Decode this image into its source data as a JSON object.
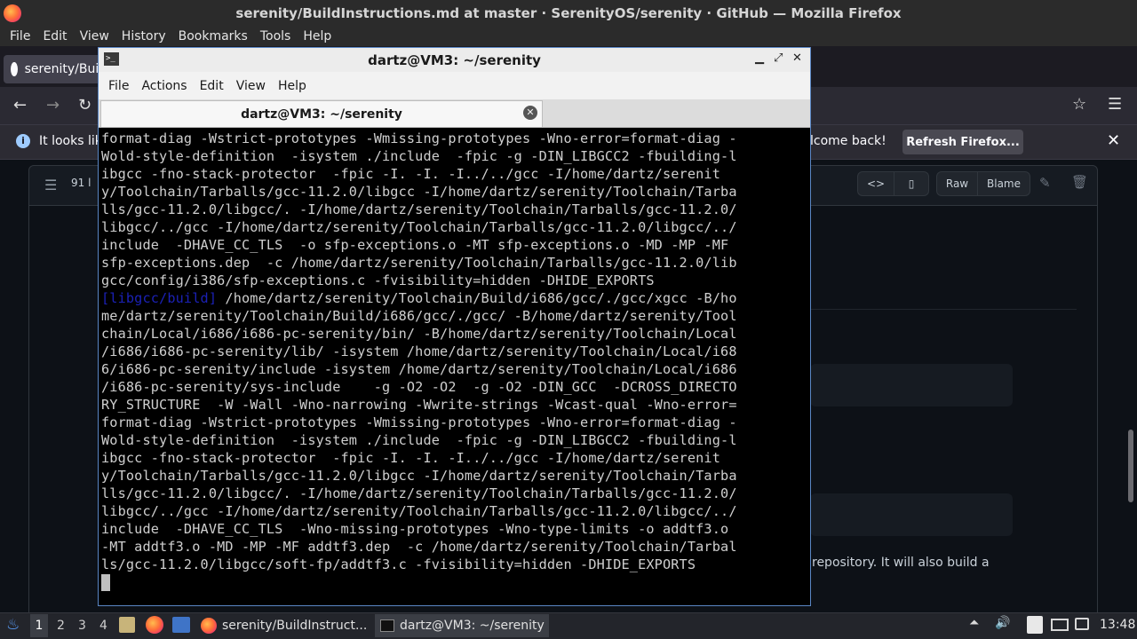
{
  "firefox": {
    "window_title": "serenity/BuildInstructions.md at master · SerenityOS/serenity · GitHub — Mozilla Firefox",
    "menu": [
      "File",
      "Edit",
      "View",
      "History",
      "Bookmarks",
      "Tools",
      "Help"
    ],
    "tab_label": "serenity/Build",
    "notification": {
      "text_left": "It looks lik",
      "text_right": "lcome back!",
      "button": "Refresh Firefox..."
    }
  },
  "github": {
    "lines_info": "91 l",
    "raw_label": "Raw",
    "blame_label": "Blame",
    "paragraph_fragment": "repository. It will also build a"
  },
  "terminal": {
    "title": "dartz@VM3: ~/serenity",
    "tab_title": "dartz@VM3: ~/serenity",
    "menu": [
      "File",
      "Actions",
      "Edit",
      "View",
      "Help"
    ],
    "line_prefix": "[libgcc/build]",
    "lines": [
      "format-diag -Wstrict-prototypes -Wmissing-prototypes -Wno-error=format-diag -",
      "Wold-style-definition  -isystem ./include  -fpic -g -DIN_LIBGCC2 -fbuilding-l",
      "ibgcc -fno-stack-protector  -fpic -I. -I. -I../../gcc -I/home/dartz/serenit",
      "y/Toolchain/Tarballs/gcc-11.2.0/libgcc -I/home/dartz/serenity/Toolchain/Tarba",
      "lls/gcc-11.2.0/libgcc/. -I/home/dartz/serenity/Toolchain/Tarballs/gcc-11.2.0/",
      "libgcc/../gcc -I/home/dartz/serenity/Toolchain/Tarballs/gcc-11.2.0/libgcc/../",
      "include  -DHAVE_CC_TLS  -o sfp-exceptions.o -MT sfp-exceptions.o -MD -MP -MF",
      "sfp-exceptions.dep  -c /home/dartz/serenity/Toolchain/Tarballs/gcc-11.2.0/lib",
      "gcc/config/i386/sfp-exceptions.c -fvisibility=hidden -DHIDE_EXPORTS",
      " /home/dartz/serenity/Toolchain/Build/i686/gcc/./gcc/xgcc -B/ho",
      "me/dartz/serenity/Toolchain/Build/i686/gcc/./gcc/ -B/home/dartz/serenity/Tool",
      "chain/Local/i686/i686-pc-serenity/bin/ -B/home/dartz/serenity/Toolchain/Local",
      "/i686/i686-pc-serenity/lib/ -isystem /home/dartz/serenity/Toolchain/Local/i68",
      "6/i686-pc-serenity/include -isystem /home/dartz/serenity/Toolchain/Local/i686",
      "/i686-pc-serenity/sys-include    -g -O2 -O2  -g -O2 -DIN_GCC  -DCROSS_DIRECTO",
      "RY_STRUCTURE  -W -Wall -Wno-narrowing -Wwrite-strings -Wcast-qual -Wno-error=",
      "format-diag -Wstrict-prototypes -Wmissing-prototypes -Wno-error=format-diag -",
      "Wold-style-definition  -isystem ./include  -fpic -g -DIN_LIBGCC2 -fbuilding-l",
      "ibgcc -fno-stack-protector  -fpic -I. -I. -I../../gcc -I/home/dartz/serenit",
      "y/Toolchain/Tarballs/gcc-11.2.0/libgcc -I/home/dartz/serenity/Toolchain/Tarba",
      "lls/gcc-11.2.0/libgcc/. -I/home/dartz/serenity/Toolchain/Tarballs/gcc-11.2.0/",
      "libgcc/../gcc -I/home/dartz/serenity/Toolchain/Tarballs/gcc-11.2.0/libgcc/../",
      "include  -DHAVE_CC_TLS  -Wno-missing-prototypes -Wno-type-limits -o addtf3.o",
      "-MT addtf3.o -MD -MP -MF addtf3.dep  -c /home/dartz/serenity/Toolchain/Tarbal",
      "ls/gcc-11.2.0/libgcc/soft-fp/addtf3.c -fvisibility=hidden -DHIDE_EXPORTS"
    ]
  },
  "taskbar": {
    "workspaces": [
      "1",
      "2",
      "3",
      "4"
    ],
    "firefox_task": "serenity/BuildInstruct...",
    "terminal_task": "dartz@VM3: ~/serenity",
    "clock": "13:48"
  },
  "colors": {
    "terminal_bg": "#000000",
    "terminal_fg": "#cfcfcf",
    "terminal_prefix": "#1b21b6",
    "github_bg": "#0d1117"
  }
}
